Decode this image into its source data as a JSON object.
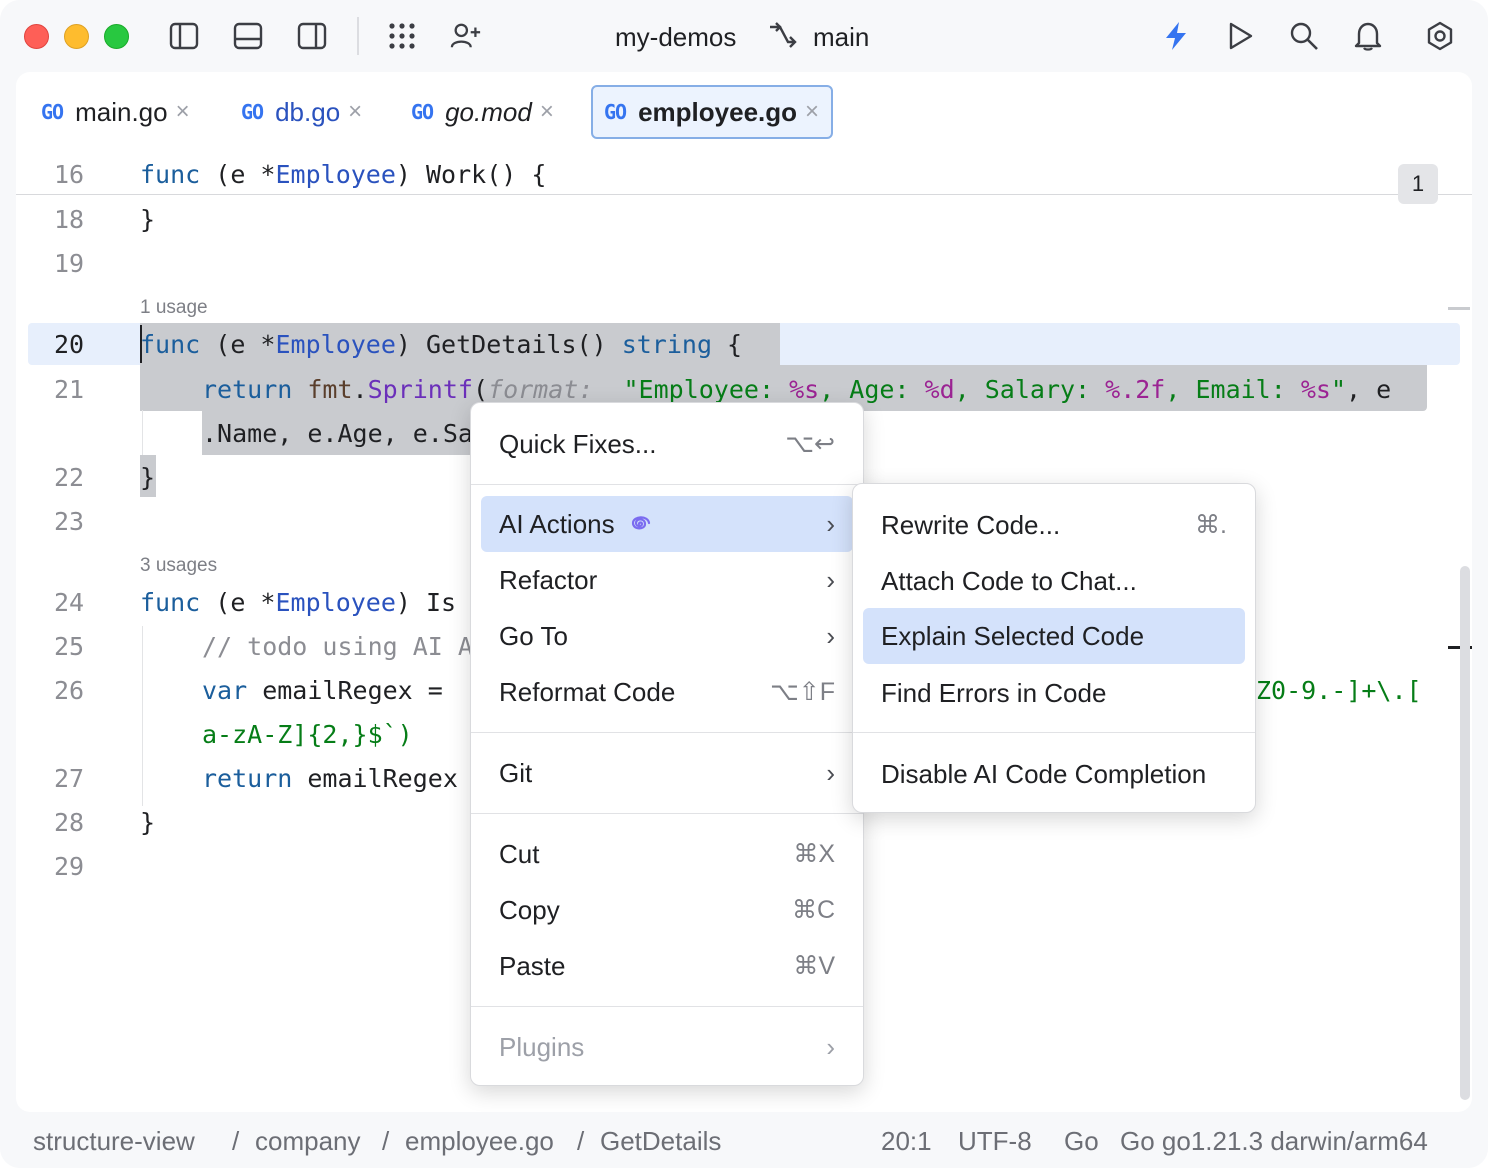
{
  "titlebar": {
    "project": "my-demos",
    "branch": "main"
  },
  "tabs": [
    {
      "badge": "GO",
      "name": "main.go",
      "close": "×"
    },
    {
      "badge": "GO",
      "name": "db.go",
      "close": "×"
    },
    {
      "badge": "GO",
      "name": "go.mod",
      "close": "×"
    },
    {
      "badge": "GO",
      "name": "employee.go",
      "close": "×"
    }
  ],
  "editor": {
    "inspection_count": "1",
    "usage_1": "1 usage",
    "usage_3": "3 usages",
    "lines": {
      "16": {
        "num": "16"
      },
      "18": {
        "num": "18"
      },
      "19": {
        "num": "19"
      },
      "20": {
        "num": "20"
      },
      "21": {
        "num": "21"
      },
      "22": {
        "num": "22"
      },
      "23": {
        "num": "23"
      },
      "24": {
        "num": "24"
      },
      "25": {
        "num": "25"
      },
      "26": {
        "num": "26"
      },
      "27": {
        "num": "27"
      },
      "28": {
        "num": "28"
      },
      "29": {
        "num": "29"
      }
    },
    "code": {
      "l16_kw": "func",
      "l16_a": " (e *",
      "l16_ty": "Employee",
      "l16_b": ") Work() {",
      "l18": "}",
      "l20_kw": "func",
      "l20_a": " (e *",
      "l20_ty": "Employee",
      "l20_b": ") GetDetails() ",
      "l20_kw2": "string",
      "l20_c": " {",
      "l21_kw": "return",
      "l21_pkg": "fmt",
      "l21_dot": ".",
      "l21_m": "Sprintf",
      "l21_p": "(",
      "l21_hint": "format:",
      "l21_s1": "\"Employee: ",
      "l21_f1": "%s",
      "l21_s2": ", Age: ",
      "l21_f2": "%d",
      "l21_s3": ", Salary: ",
      "l21_f3": "%.2f",
      "l21_s4": ", Email: ",
      "l21_f4": "%s",
      "l21_s5": "\"",
      "l21_e": ", e",
      "l21w": ".Name, e.Age, e.Sa",
      "l22": "}",
      "l24_kw": "func",
      "l24_a": " (e *",
      "l24_ty": "Employee",
      "l24_b": ") Is",
      "l25": "// todo using AI A",
      "l26_kw": "var",
      "l26_a": " emailRegex =",
      "l26_tail": "Z0-9.-]+\\.[",
      "l26w": "a-zA-Z]{2,}$`)",
      "l27_kw": "return",
      "l27_a": " emailRegex",
      "l28": "}"
    }
  },
  "context_menu": {
    "quick_fixes": {
      "label": "Quick Fixes...",
      "shortcut": "⌥↩"
    },
    "ai_actions": {
      "label": "AI Actions"
    },
    "refactor": {
      "label": "Refactor"
    },
    "go_to": {
      "label": "Go To"
    },
    "reformat": {
      "label": "Reformat Code",
      "shortcut": "⌥⇧F"
    },
    "git": {
      "label": "Git"
    },
    "cut": {
      "label": "Cut",
      "shortcut": "⌘X"
    },
    "copy": {
      "label": "Copy",
      "shortcut": "⌘C"
    },
    "paste": {
      "label": "Paste",
      "shortcut": "⌘V"
    },
    "plugins": {
      "label": "Plugins"
    },
    "chevron": "›"
  },
  "ai_submenu": {
    "rewrite": {
      "label": "Rewrite Code...",
      "shortcut": "⌘."
    },
    "attach": {
      "label": "Attach Code to Chat..."
    },
    "explain": {
      "label": "Explain Selected Code"
    },
    "find_errors": {
      "label": "Find Errors in Code"
    },
    "disable": {
      "label": "Disable AI Code Completion"
    }
  },
  "statusbar": {
    "crumbs": [
      "structure-view",
      "company",
      "employee.go",
      "GetDetails"
    ],
    "separator": "/",
    "position": "20:1",
    "encoding": "UTF-8",
    "language": "Go",
    "sdk": "Go go1.21.3 darwin/arm64"
  },
  "colors": {
    "accent": "#3574f0",
    "menu_highlight": "#d4e2fb",
    "selection": "#c9cbcf"
  }
}
